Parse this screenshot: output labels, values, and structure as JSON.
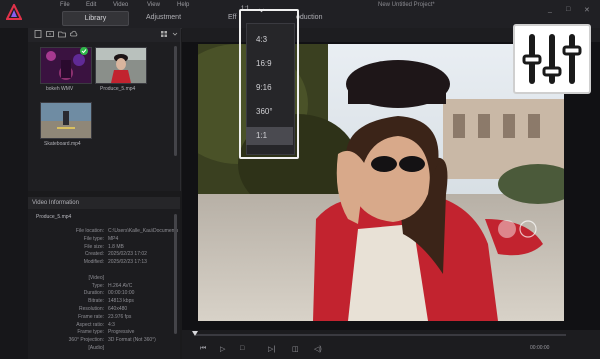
{
  "app": {
    "menu": [
      "File",
      "Edit",
      "Video",
      "View",
      "Help"
    ],
    "project_title": "New Untitled Project*",
    "window_controls": [
      "_",
      "□",
      "✕"
    ]
  },
  "tabs": {
    "library": "Library",
    "adjustment": "Adjustment",
    "effects": "Eff",
    "production": "oduction"
  },
  "library": {
    "items": [
      {
        "label": "bokeh WMV"
      },
      {
        "label": "Produce_5.mp4"
      },
      {
        "label": "Skateboard.mp4"
      }
    ]
  },
  "video_info": {
    "header": "Video Information",
    "filename": "Produce_5.mp4",
    "rows": [
      {
        "k": "File location:",
        "v": "C:\\Users\\Kalle_Kau\\Documents\\C..."
      },
      {
        "k": "File type:",
        "v": "MP4"
      },
      {
        "k": "File size:",
        "v": "1.8 MB"
      },
      {
        "k": "Created:",
        "v": "2025/02/23 17:02"
      },
      {
        "k": "Modified:",
        "v": "2025/02/23 17:13"
      },
      {
        "k": "",
        "v": ""
      },
      {
        "k": "[Video]",
        "v": ""
      },
      {
        "k": "Type:",
        "v": "H.264 AVC"
      },
      {
        "k": "Duration:",
        "v": "00:00:10:00"
      },
      {
        "k": "Bitrate:",
        "v": "14813 kbps"
      },
      {
        "k": "Resolution:",
        "v": "640x480"
      },
      {
        "k": "Frame rate:",
        "v": "23.976 fps"
      },
      {
        "k": "Aspect ratio:",
        "v": "4:3"
      },
      {
        "k": "Frame type:",
        "v": "Progressive"
      },
      {
        "k": "360° Projection:",
        "v": "3D Format (Not 360°)"
      },
      {
        "k": "[Audio]",
        "v": ""
      }
    ]
  },
  "aspect_ratio": {
    "current": "1:1",
    "options": [
      "4:3",
      "16:9",
      "9:16",
      "360°",
      "1:1"
    ],
    "selected_index": 4
  },
  "playback": {
    "time": "00:00:00"
  },
  "colors": {
    "accent": "#e0324a",
    "jacket": "#c2232f",
    "sky": "#dfe6ee"
  },
  "icons": [
    "app-logo-icon",
    "settings-sliders-icon",
    "play-icon",
    "stop-icon"
  ]
}
